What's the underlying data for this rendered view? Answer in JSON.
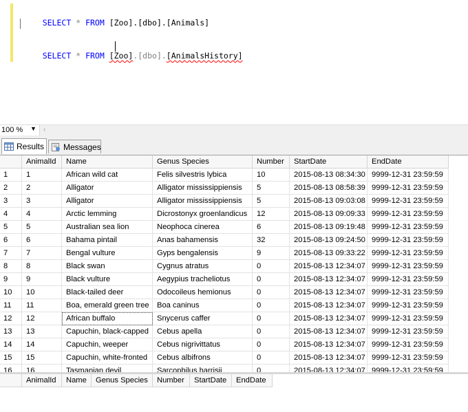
{
  "editor": {
    "query1": {
      "kw1": "SELECT",
      "op": "*",
      "kw2": "FROM",
      "target": "[Zoo].[dbo].[Animals]"
    },
    "query2": {
      "kw1": "SELECT",
      "op": "*",
      "kw2": "FROM",
      "target_a": "[Zoo]",
      "target_b": ".[dbo].",
      "target_c": "[AnimalsHistory]"
    }
  },
  "zoom": {
    "value": "100 %"
  },
  "tabs": [
    {
      "label": "Results",
      "icon": "grid-icon"
    },
    {
      "label": "Messages",
      "icon": "messages-icon"
    }
  ],
  "results": {
    "columns": [
      "AnimalId",
      "Name",
      "Genus Species",
      "Number",
      "StartDate",
      "EndDate"
    ],
    "rows": [
      [
        "1",
        "1",
        "African wild cat",
        "Felis silvestris lybica",
        "10",
        "2015-08-13 08:34:30",
        "9999-12-31 23:59:59"
      ],
      [
        "2",
        "2",
        "Alligator",
        "Alligator mississippiensis",
        "5",
        "2015-08-13 08:58:39",
        "9999-12-31 23:59:59"
      ],
      [
        "3",
        "3",
        "Alligator",
        "Alligator mississippiensis",
        "5",
        "2015-08-13 09:03:08",
        "9999-12-31 23:59:59"
      ],
      [
        "4",
        "4",
        "Arctic lemming",
        "Dicrostonyx groenlandicus",
        "12",
        "2015-08-13 09:09:33",
        "9999-12-31 23:59:59"
      ],
      [
        "5",
        "5",
        "Australian sea lion",
        "Neophoca cinerea",
        "6",
        "2015-08-13 09:19:48",
        "9999-12-31 23:59:59"
      ],
      [
        "6",
        "6",
        "Bahama pintail",
        "Anas bahamensis",
        "32",
        "2015-08-13 09:24:50",
        "9999-12-31 23:59:59"
      ],
      [
        "7",
        "7",
        "Bengal vulture",
        "Gyps bengalensis",
        "9",
        "2015-08-13 09:33:22",
        "9999-12-31 23:59:59"
      ],
      [
        "8",
        "8",
        "Black swan",
        "Cygnus atratus",
        "0",
        "2015-08-13 12:34:07",
        "9999-12-31 23:59:59"
      ],
      [
        "9",
        "9",
        "Black vulture",
        "Aegypius tracheliotus",
        "0",
        "2015-08-13 12:34:07",
        "9999-12-31 23:59:59"
      ],
      [
        "10",
        "10",
        "Black-tailed deer",
        "Odocoileus hemionus",
        "0",
        "2015-08-13 12:34:07",
        "9999-12-31 23:59:59"
      ],
      [
        "11",
        "11",
        "Boa, emerald green tree",
        "Boa caninus",
        "0",
        "2015-08-13 12:34:07",
        "9999-12-31 23:59:59"
      ],
      [
        "12",
        "12",
        "African buffalo",
        "Snycerus caffer",
        "0",
        "2015-08-13 12:34:07",
        "9999-12-31 23:59:59"
      ],
      [
        "13",
        "13",
        "Capuchin, black-capped",
        "Cebus apella",
        "0",
        "2015-08-13 12:34:07",
        "9999-12-31 23:59:59"
      ],
      [
        "14",
        "14",
        "Capuchin, weeper",
        "Cebus nigrivittatus",
        "0",
        "2015-08-13 12:34:07",
        "9999-12-31 23:59:59"
      ],
      [
        "15",
        "15",
        "Capuchin, white-fronted",
        "Cebus albifrons",
        "0",
        "2015-08-13 12:34:07",
        "9999-12-31 23:59:59"
      ],
      [
        "16",
        "16",
        "Tasmanian devil",
        "Sarcophilus harrisii",
        "0",
        "2015-08-13 12:34:07",
        "9999-12-31 23:59:59"
      ]
    ],
    "selected_row": 12
  },
  "history_results": {
    "columns": [
      "AnimalId",
      "Name",
      "Genus Species",
      "Number",
      "StartDate",
      "EndDate"
    ]
  }
}
